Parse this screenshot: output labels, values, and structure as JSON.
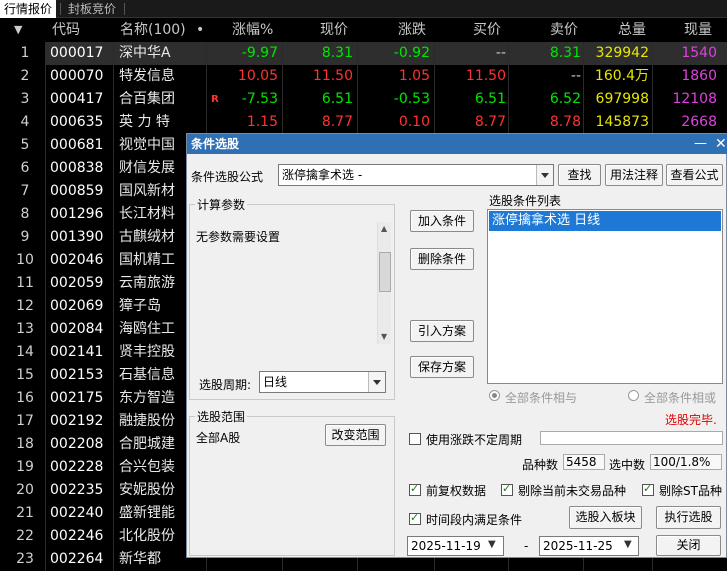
{
  "tabs": [
    "行情报价",
    "封板竞价"
  ],
  "table": {
    "headers": [
      "代码",
      "名称(100)",
      "•",
      "涨幅%",
      "现价",
      "涨跌",
      "买价",
      "卖价",
      "总量",
      "现量"
    ],
    "rows": [
      {
        "idx": "1",
        "code": "000017",
        "name": "深中华A",
        "mark": "",
        "pct": "-9.97",
        "price": "8.31",
        "chg": "-0.92",
        "bid": "--",
        "ask": "8.31",
        "vol": "329942",
        "cur": "1540",
        "dir": "down",
        "selected": true
      },
      {
        "idx": "2",
        "code": "000070",
        "name": "特发信息",
        "mark": "",
        "pct": "10.05",
        "price": "11.50",
        "chg": "1.05",
        "bid": "11.50",
        "ask": "--",
        "vol": "160.4万",
        "cur": "1860",
        "dir": "up",
        "selected": false
      },
      {
        "idx": "3",
        "code": "000417",
        "name": "合百集团",
        "mark": "R",
        "pct": "-7.53",
        "price": "6.51",
        "chg": "-0.53",
        "bid": "6.51",
        "ask": "6.52",
        "vol": "697998",
        "cur": "12108",
        "dir": "down",
        "selected": false
      },
      {
        "idx": "4",
        "code": "000635",
        "name": "英 力 特",
        "mark": "",
        "pct": "1.15",
        "price": "8.77",
        "chg": "0.10",
        "bid": "8.77",
        "ask": "8.78",
        "vol": "145873",
        "cur": "2668",
        "dir": "up",
        "selected": false
      },
      {
        "idx": "5",
        "code": "000681",
        "name": "视觉中国"
      },
      {
        "idx": "6",
        "code": "000838",
        "name": "财信发展"
      },
      {
        "idx": "7",
        "code": "000859",
        "name": "国风新材"
      },
      {
        "idx": "8",
        "code": "001296",
        "name": "长江材料"
      },
      {
        "idx": "9",
        "code": "001390",
        "name": "古麒绒材"
      },
      {
        "idx": "10",
        "code": "002046",
        "name": "国机精工"
      },
      {
        "idx": "11",
        "code": "002059",
        "name": "云南旅游"
      },
      {
        "idx": "12",
        "code": "002069",
        "name": "獐子岛"
      },
      {
        "idx": "13",
        "code": "002084",
        "name": "海鸥住工"
      },
      {
        "idx": "14",
        "code": "002141",
        "name": "贤丰控股"
      },
      {
        "idx": "15",
        "code": "002153",
        "name": "石基信息"
      },
      {
        "idx": "16",
        "code": "002175",
        "name": "东方智造"
      },
      {
        "idx": "17",
        "code": "002192",
        "name": "融捷股份"
      },
      {
        "idx": "18",
        "code": "002208",
        "name": "合肥城建"
      },
      {
        "idx": "19",
        "code": "002228",
        "name": "合兴包装"
      },
      {
        "idx": "20",
        "code": "002235",
        "name": "安妮股份"
      },
      {
        "idx": "21",
        "code": "002240",
        "name": "盛新锂能"
      },
      {
        "idx": "22",
        "code": "002246",
        "name": "北化股份"
      },
      {
        "idx": "23",
        "code": "002264",
        "name": "新华都"
      }
    ]
  },
  "colors": {
    "up": "#ff3232",
    "down": "#00e600",
    "flat": "#c8c8c8",
    "code": "#ffffff",
    "vol": "#e6e600",
    "cur": "#e040e0"
  },
  "dialog": {
    "title": "条件选股",
    "formula_label": "条件选股公式",
    "formula_value": "涨停擒拿术选  -",
    "btn_find": "查找",
    "btn_usage": "用法注释",
    "btn_view": "查看公式",
    "params_title": "计算参数",
    "params_text": "无参数需要设置",
    "period_label": "选股周期:",
    "period_value": "日线",
    "btn_add": "加入条件",
    "btn_delete": "删除条件",
    "btn_import": "引入方案",
    "btn_save": "保存方案",
    "cond_list_title": "选股条件列表",
    "cond_items": [
      "涨停擒拿术选  日线"
    ],
    "radio_and": "全部条件相与",
    "radio_or": "全部条件相或",
    "status": "选股完毕.",
    "range_title": "选股范围",
    "range_value": "全部A股",
    "btn_change_range": "改变范围",
    "chk_period": "使用涨跌不定周期",
    "count_label": "品种数",
    "count_value": "5458",
    "selected_label": "选中数",
    "selected_value": "100/1.8%",
    "chk_fq": "前复权数据",
    "chk_untraded": "剔除当前未交易品种",
    "chk_st": "剔除ST品种",
    "chk_interval": "时间段内满足条件",
    "btn_to_block": "选股入板块",
    "btn_exec": "执行选股",
    "date_from": "2025-11-19",
    "date_sep": "-",
    "date_to": "2025-11-25",
    "btn_close": "关闭"
  }
}
